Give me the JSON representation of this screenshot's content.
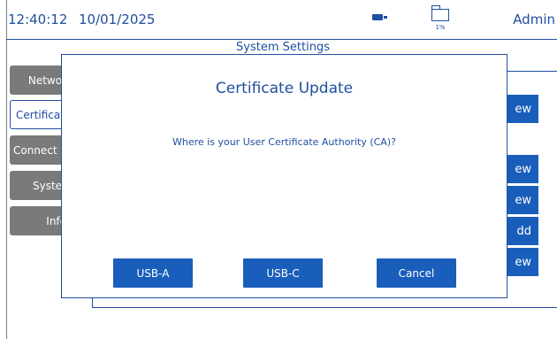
{
  "status_bar": {
    "time": "12:40:12",
    "date": "10/01/2025",
    "storage_percent": "1%",
    "user": "Admin",
    "icons": [
      "battery-icon",
      "folder-icon"
    ]
  },
  "page": {
    "title": "System Settings"
  },
  "sidebar": {
    "items": [
      {
        "label": "Networ"
      },
      {
        "label": "Certificat"
      },
      {
        "label": "Connect &"
      },
      {
        "label": "Syster"
      },
      {
        "label": "Info"
      }
    ]
  },
  "content_buttons": {
    "items": [
      {
        "label": "ew"
      },
      {
        "label": "ew"
      },
      {
        "label": "ew"
      },
      {
        "label": "dd"
      },
      {
        "label": "ew"
      }
    ]
  },
  "dialog": {
    "title": "Certificate Update",
    "question": "Where is your User Certificate Authority (CA)?",
    "buttons": {
      "usb_a": "USB-A",
      "usb_c": "USB-C",
      "cancel": "Cancel"
    }
  },
  "colors": {
    "primary": "#1a5ebc",
    "text": "#1f4fa0",
    "inactive": "#7a7a7a"
  }
}
